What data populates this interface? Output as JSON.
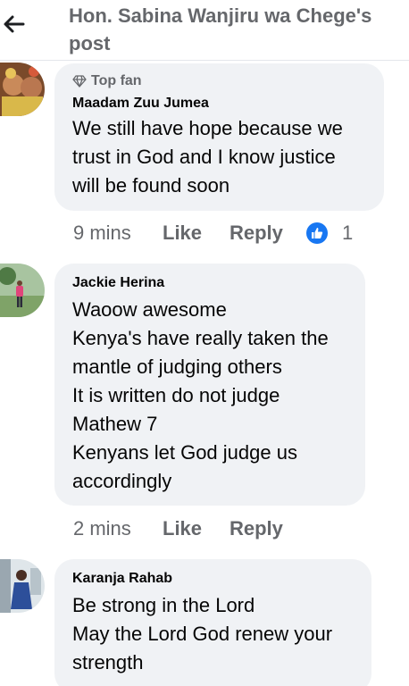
{
  "header": {
    "title": "Hon. Sabina Wanjiru wa Chege's post",
    "back_icon": "arrow-left-icon"
  },
  "comments": [
    {
      "badge": "Top fan",
      "author": "Maadam Zuu Jumea",
      "text": "We still have hope because we trust in God and I know justice will be found soon",
      "time": "9 mins",
      "like_label": "Like",
      "reply_label": "Reply",
      "reaction_icon": "thumbs-up-icon",
      "reaction_count": "1"
    },
    {
      "author": "Jackie Herina",
      "text": "Waoow awesome\nKenya's have really taken the mantle of judging others\nIt is written do not judge\nMathew 7\nKenyans let God judge us accordingly",
      "time": "2 mins",
      "like_label": "Like",
      "reply_label": "Reply"
    },
    {
      "author": "Karanja Rahab",
      "text": "Be strong in the Lord\nMay the Lord God renew your strength"
    }
  ],
  "colors": {
    "accent": "#1877f2",
    "bubble": "#f0f2f5",
    "secondary_text": "#65676b"
  }
}
